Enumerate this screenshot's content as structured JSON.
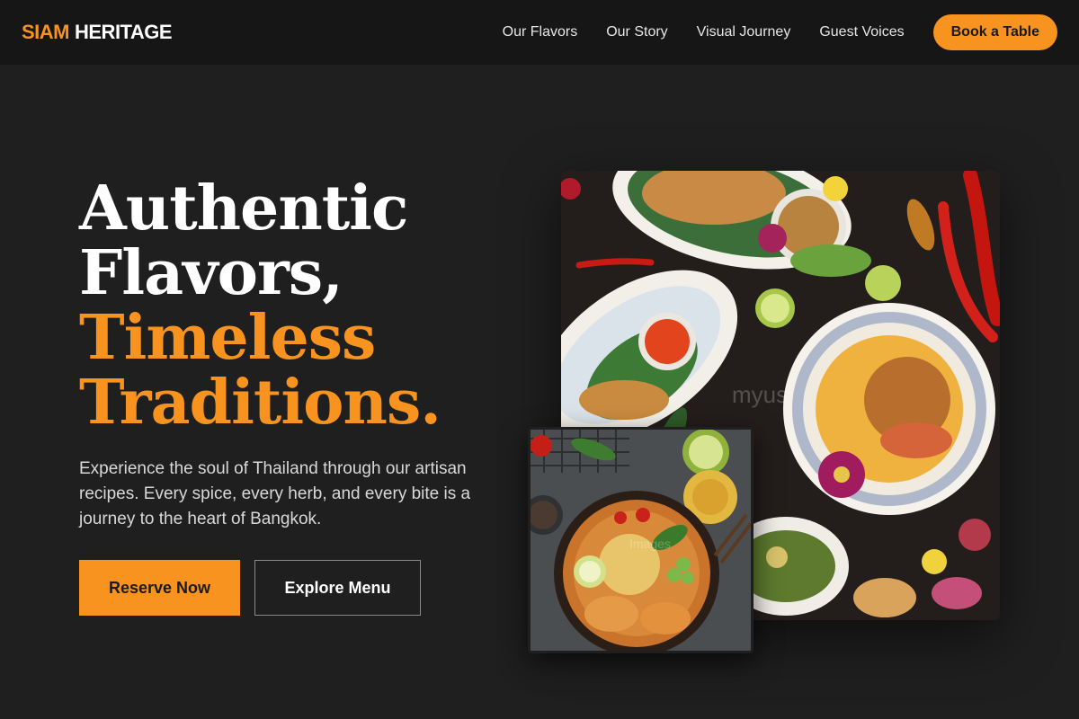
{
  "brand": {
    "first": "SIAM",
    "second": "HERITAGE"
  },
  "nav": {
    "links": [
      "Our Flavors",
      "Our Story",
      "Visual Journey",
      "Guest Voices"
    ],
    "cta": "Book a Table"
  },
  "hero": {
    "title_lines": [
      "Authentic",
      "Flavors,",
      "Timeless",
      "Traditions."
    ],
    "description": "Experience the soul of Thailand through our artisan recipes. Every spice, every herb, and every bite is a journey to the heart of Bangkok.",
    "primary_button": "Reserve Now",
    "secondary_button": "Explore Menu"
  },
  "images": {
    "main_watermark": "myus",
    "small_watermark": "Images"
  },
  "colors": {
    "accent": "#f7931e",
    "background": "#1f1f1f",
    "nav_bg": "#161616"
  }
}
